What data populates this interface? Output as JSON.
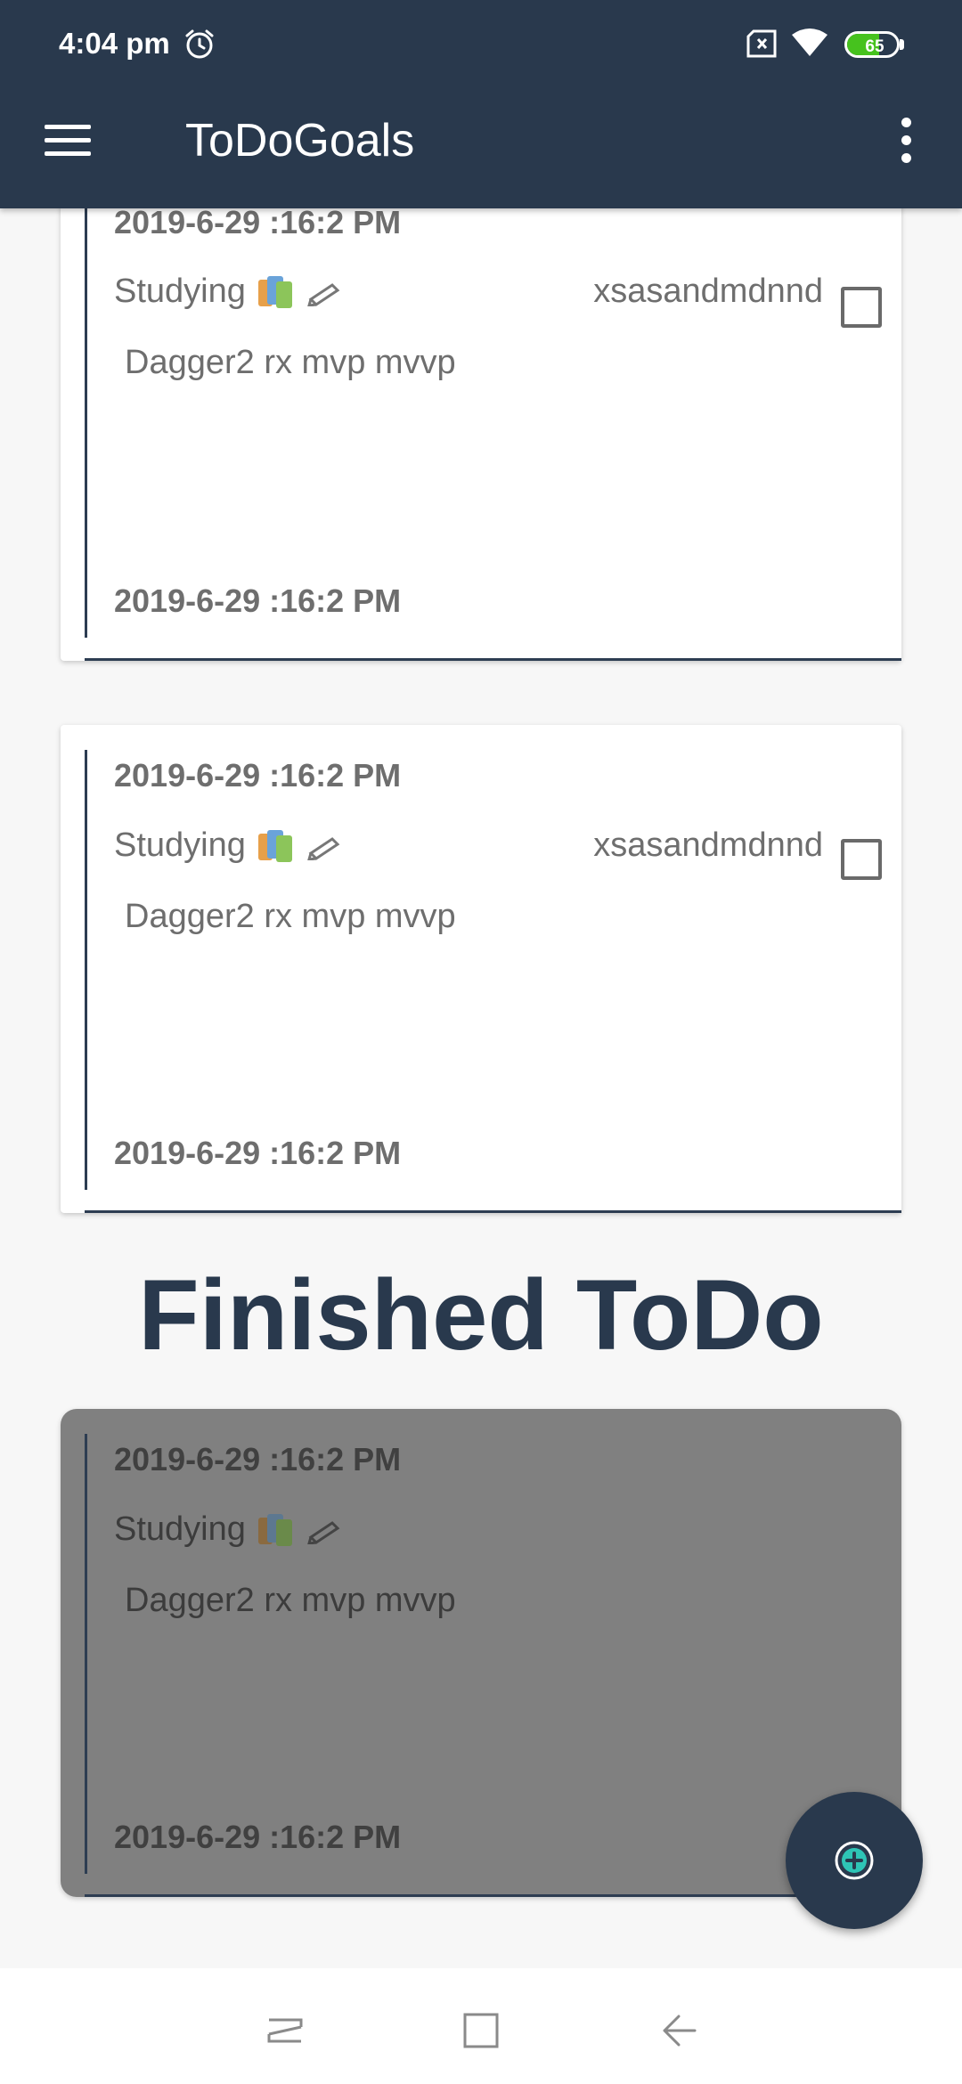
{
  "status_bar": {
    "time": "4:04 pm",
    "battery_level": "65",
    "battery_fraction": 0.65,
    "icons": [
      "alarm-icon",
      "sim-off-icon",
      "wifi-icon",
      "battery-icon"
    ]
  },
  "app_bar": {
    "title": "ToDoGoals",
    "menu_icon": "hamburger-menu-icon",
    "overflow_icon": "more-vert-icon"
  },
  "colors": {
    "primary": "#29394d",
    "card_bg": "#ffffff",
    "finished_card_bg": "#808080",
    "battery_green": "#46c21e"
  },
  "todo_cards": [
    {
      "created": "2019-6-29 :16:2 PM",
      "category": "Studying",
      "assignee": "xsasandmdnnd",
      "description": "Dagger2 rx mvp mvvp",
      "due": "2019-6-29 :16:2 PM",
      "checked": false
    },
    {
      "created": "2019-6-29 :16:2 PM",
      "category": "Studying",
      "assignee": "xsasandmdnnd",
      "description": "Dagger2 rx mvp mvvp",
      "due": "2019-6-29 :16:2 PM",
      "checked": false
    }
  ],
  "finished_section": {
    "title": "Finished ToDo",
    "cards": [
      {
        "created": "2019-6-29 :16:2 PM",
        "category": "Studying",
        "description": "Dagger2 rx mvp mvvp",
        "due": "2019-6-29 :16:2 PM"
      }
    ]
  },
  "fab": {
    "icon": "add-circle-icon"
  },
  "nav_bar": {
    "icons": [
      "recents-icon",
      "home-icon",
      "back-icon"
    ]
  }
}
